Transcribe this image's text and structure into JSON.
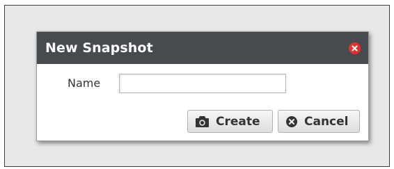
{
  "dialog": {
    "title": "New Snapshot",
    "close_icon": "close-circle-icon",
    "name_label": "Name",
    "name_value": "",
    "buttons": {
      "create_label": "Create",
      "create_icon": "camera-icon",
      "cancel_label": "Cancel",
      "cancel_icon": "cancel-circle-icon"
    }
  },
  "colors": {
    "titlebar": "#474b50",
    "close": "#e52f2f",
    "backdrop": "#e8e8e8"
  }
}
